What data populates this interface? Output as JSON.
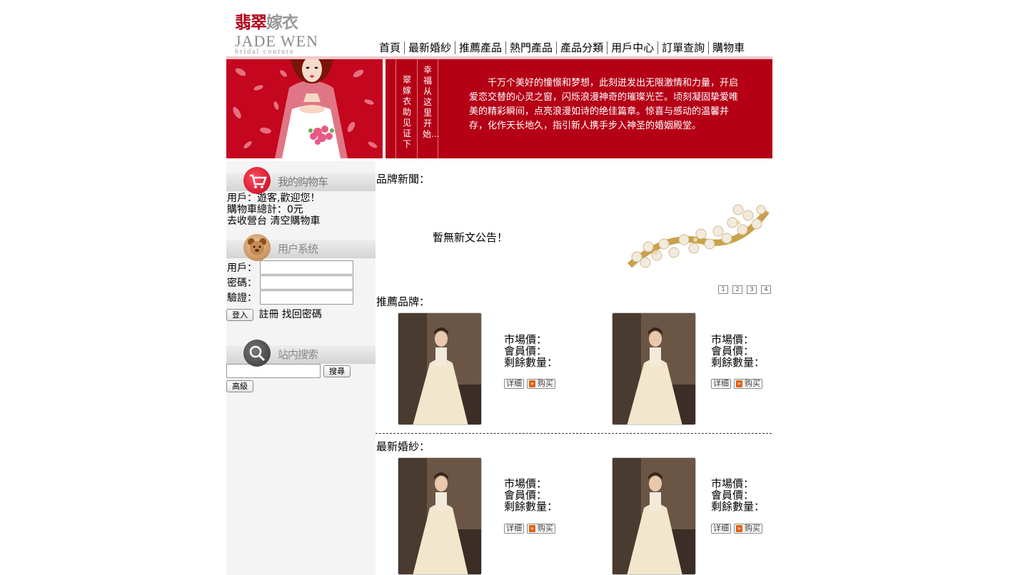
{
  "logo": {
    "cn_red": "翡翠",
    "cn_grey": "嫁衣",
    "en": "JADE WEN",
    "sub": "bridal couture"
  },
  "nav": [
    "首頁",
    "最新婚紗",
    "推薦產品",
    "熱門產品",
    "產品分類",
    "用戶中心",
    "訂單查詢",
    "購物車"
  ],
  "banner": {
    "vertical_1": "幸福从这里开始...",
    "vertical_2": "翠嫁衣助见证下",
    "text": "千万个美好的憧憬和梦想，此刻迸发出无限激情和力量，开启爱恋交替的心灵之窗，闪烁浪漫神奇的璀璨光芒。顷刻凝固挚爱唯美的精彩瞬间，点亮浪漫如诗的绝佳篇章。惊喜与感动的温馨并存，化作天长地久，指引新人携手步入神圣的婚姻殿堂。"
  },
  "cart": {
    "title": "我的购物车",
    "user_line": "用戶：遊客,歡迎您！",
    "total_line": "購物車總計：0元",
    "checkout_link": "去收營台",
    "clear_link": "清空購物車"
  },
  "user_system": {
    "title": "用户系统",
    "user_label": "用戶：",
    "password_label": "密碼：",
    "verify_label": "驗證：",
    "login_button": "登入",
    "register_link": "註冊",
    "recover_link": "找回密碼"
  },
  "search": {
    "title": "站内搜索",
    "button": "搜尋",
    "advanced_button": "高級"
  },
  "news": {
    "heading": "品牌新聞：",
    "empty_message": "暫無新文公告！",
    "pages": [
      "1",
      "2",
      "3",
      "4"
    ]
  },
  "recommended": {
    "heading": "推薦品牌：",
    "products": [
      {
        "market_price": "市場價：",
        "member_price": "會員價：",
        "stock": "剩餘數量：",
        "detail": "详细",
        "buy": "购买"
      },
      {
        "market_price": "市場價：",
        "member_price": "會員價：",
        "stock": "剩餘數量：",
        "detail": "详细",
        "buy": "购买"
      }
    ]
  },
  "latest": {
    "heading": "最新婚紗：",
    "products": [
      {
        "market_price": "市場價：",
        "member_price": "會員價：",
        "stock": "剩餘數量：",
        "detail": "详细",
        "buy": "购买"
      },
      {
        "market_price": "市場價：",
        "member_price": "會員價：",
        "stock": "剩餘數量：",
        "detail": "详细",
        "buy": "购买"
      }
    ]
  },
  "colors": {
    "brand_red": "#b50016",
    "sidebar_bg": "#f4f4f4"
  }
}
